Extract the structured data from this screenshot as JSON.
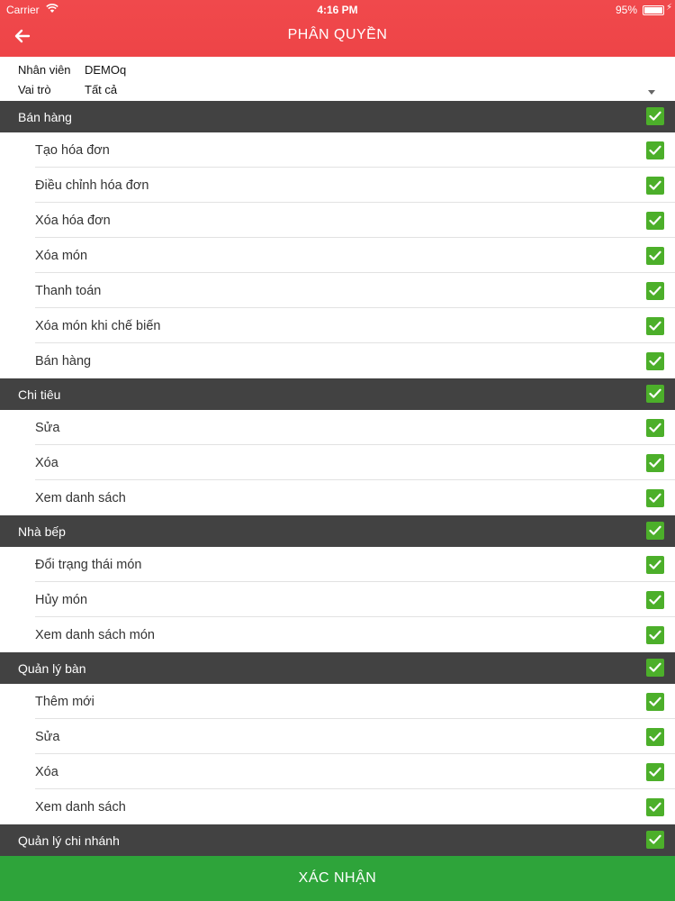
{
  "status_bar": {
    "carrier": "Carrier",
    "time": "4:16 PM",
    "battery": "95%"
  },
  "header": {
    "title": "PHÂN QUYỀN",
    "back_icon": "arrow-left-icon"
  },
  "filter": {
    "employee_label": "Nhân viên",
    "employee_value": "DEMOq",
    "role_label": "Vai trò",
    "role_value": "Tất cả"
  },
  "colors": {
    "header": "#ee4447",
    "section": "#424242",
    "check": "#4caf2a",
    "confirm": "#2ea43a"
  },
  "sections": [
    {
      "label": "Bán hàng",
      "checked": true,
      "items": [
        {
          "label": "Tạo hóa đơn",
          "checked": true
        },
        {
          "label": "Điều chỉnh hóa đơn",
          "checked": true
        },
        {
          "label": "Xóa hóa đơn",
          "checked": true
        },
        {
          "label": "Xóa món",
          "checked": true
        },
        {
          "label": "Thanh toán",
          "checked": true
        },
        {
          "label": "Xóa món khi chế biến",
          "checked": true
        },
        {
          "label": "Bán hàng",
          "checked": true
        }
      ]
    },
    {
      "label": "Chi tiêu",
      "checked": true,
      "items": [
        {
          "label": "Sửa",
          "checked": true
        },
        {
          "label": "Xóa",
          "checked": true
        },
        {
          "label": "Xem danh sách",
          "checked": true
        }
      ]
    },
    {
      "label": "Nhà bếp",
      "checked": true,
      "items": [
        {
          "label": "Đổi trạng thái món",
          "checked": true
        },
        {
          "label": "Hủy món",
          "checked": true
        },
        {
          "label": "Xem danh sách món",
          "checked": true
        }
      ]
    },
    {
      "label": "Quản lý bàn",
      "checked": true,
      "items": [
        {
          "label": "Thêm mới",
          "checked": true
        },
        {
          "label": "Sửa",
          "checked": true
        },
        {
          "label": "Xóa",
          "checked": true
        },
        {
          "label": "Xem danh sách",
          "checked": true
        }
      ]
    },
    {
      "label": "Quản lý chi nhánh",
      "checked": true,
      "items": []
    }
  ],
  "confirm_label": "XÁC NHẬN"
}
